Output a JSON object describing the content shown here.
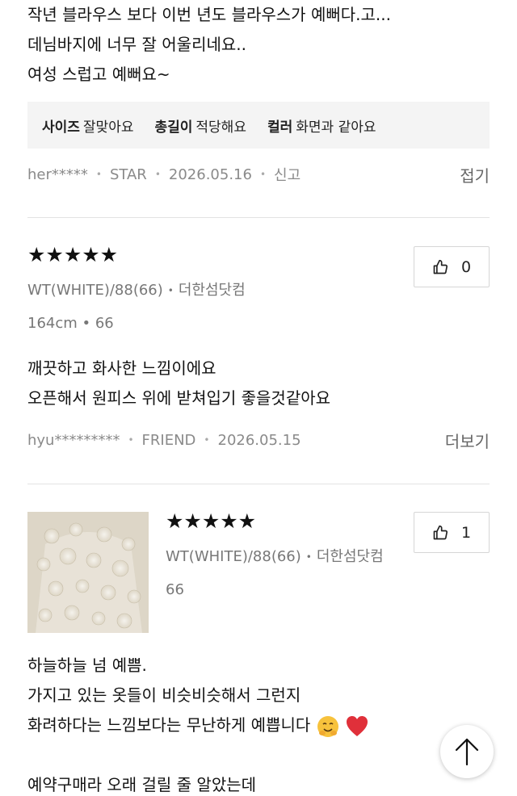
{
  "review1": {
    "lines": [
      "작년 블라우스 보다   이번 년도 블라우스가 예뻐다.고...",
      "데님바지에 너무 잘 어울리네요..",
      "여성 스럽고 예뻐요~"
    ],
    "size_info": [
      {
        "key": "사이즈",
        "value": "잘맞아요"
      },
      {
        "key": "총길이",
        "value": "적당해요"
      },
      {
        "key": "컬러",
        "value": "화면과 같아요"
      }
    ],
    "user": "her*****",
    "grade": "STAR",
    "date": "2026.05.16",
    "report": "신고",
    "collapse_label": "접기"
  },
  "review2": {
    "stars": "★★★★★",
    "option": "WT(WHITE)/88(66)",
    "seller": "더한섬닷컴",
    "body_info": "164cm • 66",
    "like_count": "0",
    "lines": [
      "깨끗하고 화사한 느낌이에요",
      "오픈해서 원피스 위에 받쳐입기 좋을것같아요"
    ],
    "user": "hyu*********",
    "grade": "FRIEND",
    "date": "2026.05.15",
    "more_label": "더보기"
  },
  "review3": {
    "stars": "★★★★★",
    "option": "WT(WHITE)/88(66)",
    "seller": "더한섬닷컴",
    "body_info": "66",
    "like_count": "1",
    "lines": [
      "하늘하늘 넘 예쁨.",
      "가지고 있는 옷들이 비슷비슷해서 그런지",
      "화려하다는 느낌보다는 무난하게 예쁩니다",
      "",
      "예약구매라 오래 걸릴 줄 알았는데"
    ]
  },
  "colors": {
    "text": "#111111",
    "muted": "#8a8a8a",
    "divider": "#e3e3e3",
    "box_bg": "#f4f4f4",
    "heart": "#e0303a"
  },
  "icons": [
    "thumbs-up-icon",
    "arrow-up-icon",
    "hugging-face-emoji",
    "red-heart-emoji"
  ]
}
